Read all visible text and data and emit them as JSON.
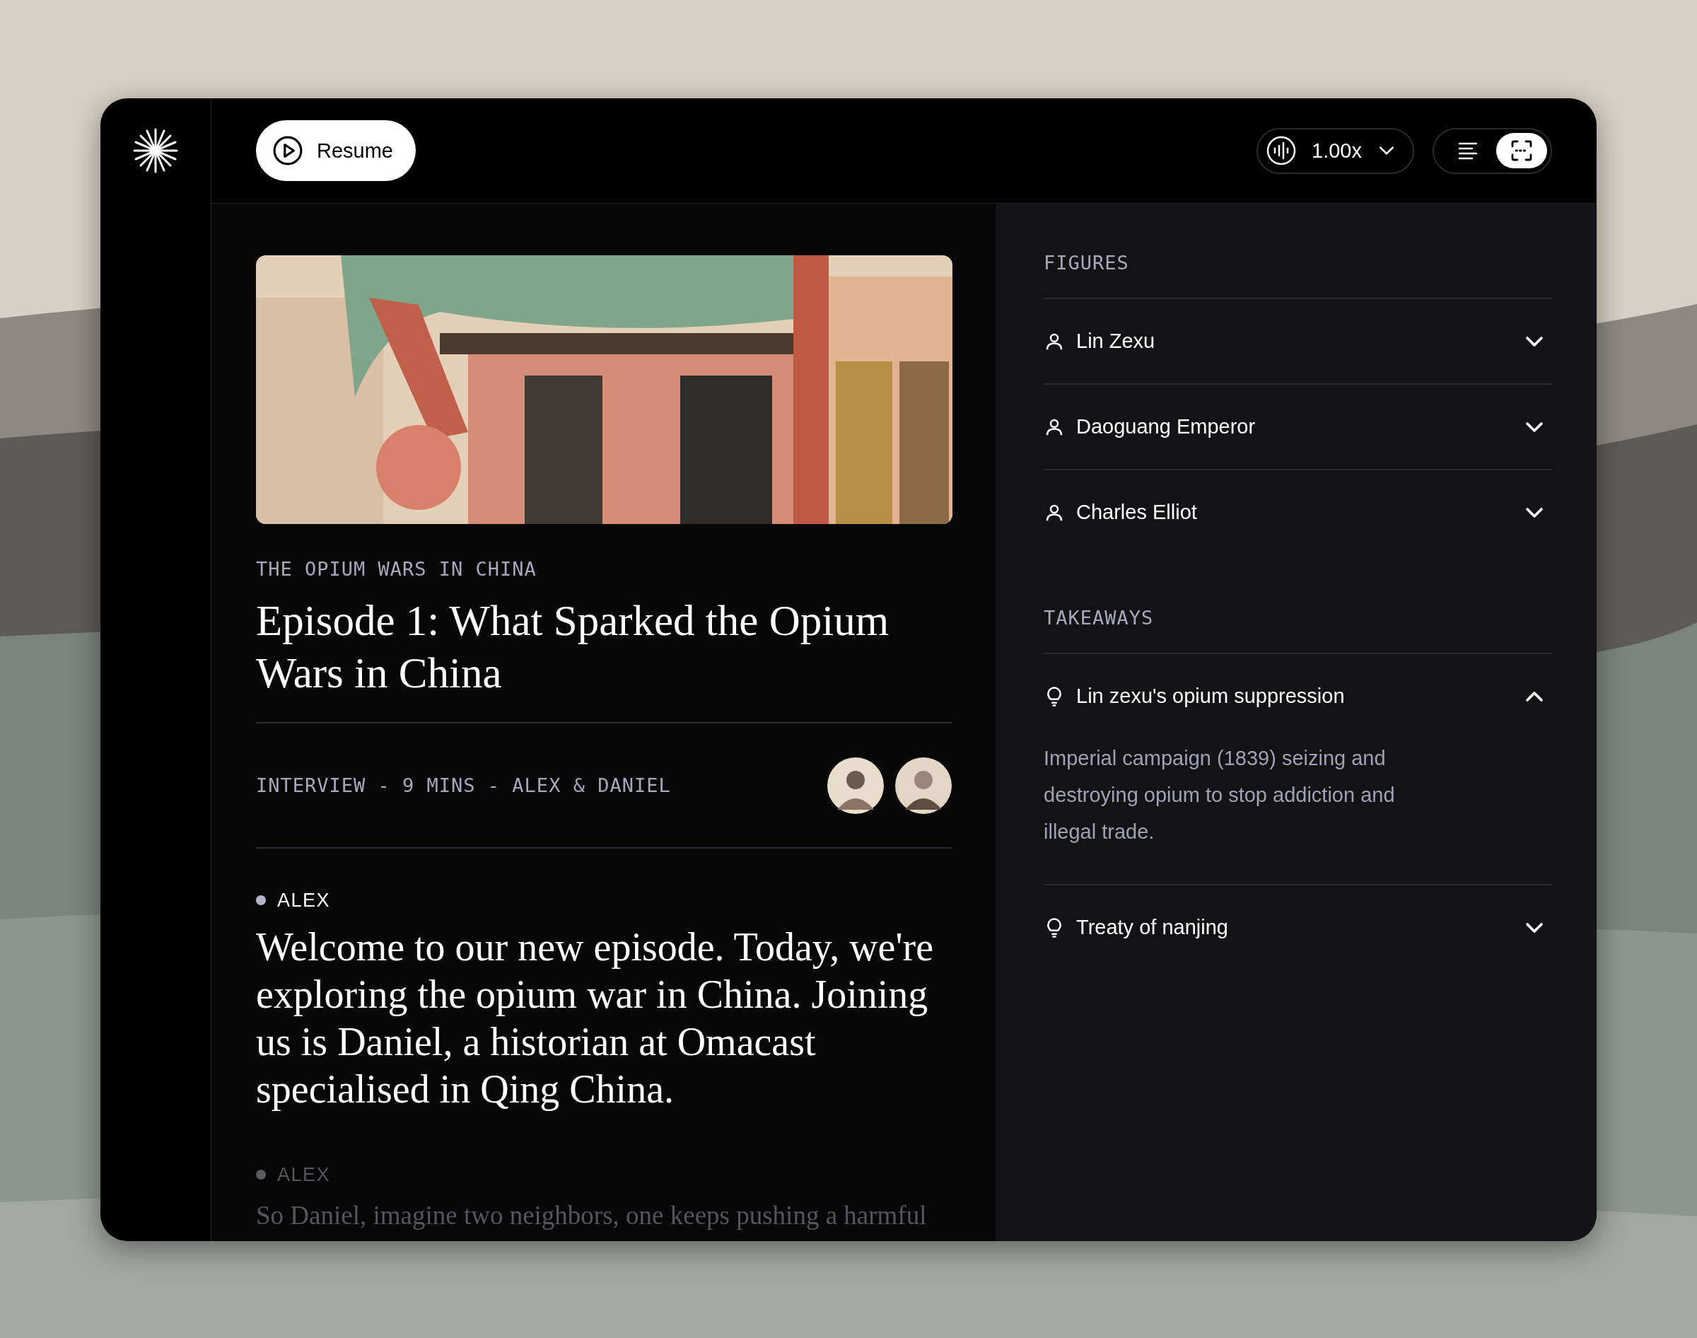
{
  "header": {
    "resume_button": "Resume",
    "speed": "1.00x",
    "view_toggle": [
      {
        "kind": "transcript",
        "selected": false
      },
      {
        "kind": "focus",
        "selected": true
      }
    ]
  },
  "episode": {
    "series": "THE OPIUM WARS IN CHINA",
    "title": "Episode 1: What Sparked the Opium Wars in China",
    "meta": "INTERVIEW - 9 MINS - ALEX & DANIEL"
  },
  "transcript": [
    {
      "speaker": "ALEX",
      "text": "Welcome to our new episode. Today, we're exploring the opium war in China. Joining us is Daniel, a historian at Omacast specialised in Qing China.",
      "active": true
    },
    {
      "speaker": "ALEX",
      "text": "So Daniel, imagine two neighbors, one keeps pushing a harmful",
      "active": false
    }
  ],
  "figures": {
    "heading": "FIGURES",
    "items": [
      {
        "name": "Lin Zexu",
        "expanded": false
      },
      {
        "name": "Daoguang Emperor",
        "expanded": false
      },
      {
        "name": "Charles Elliot",
        "expanded": false
      }
    ]
  },
  "takeaways": {
    "heading": "TAKEAWAYS",
    "items": [
      {
        "title": "Lin zexu's opium suppression",
        "expanded": true,
        "description": "Imperial campaign (1839) seizing and destroying opium to stop addiction and illegal trade."
      },
      {
        "title": "Treaty of nanjing",
        "expanded": false
      }
    ]
  }
}
